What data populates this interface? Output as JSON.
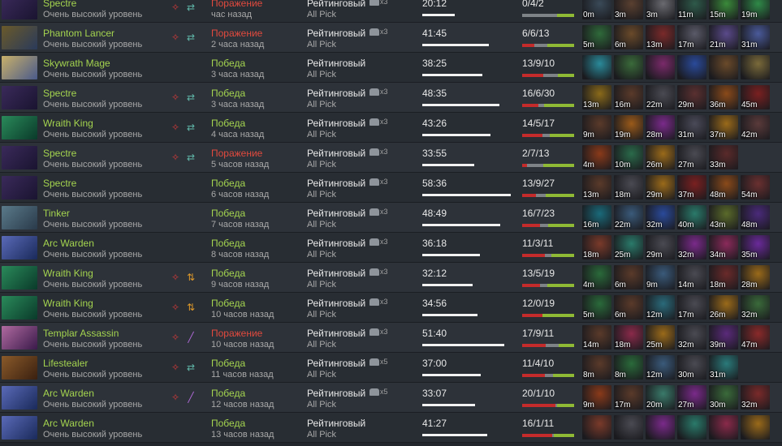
{
  "matches": [
    {
      "hero": "Spectre",
      "skill": "Очень высокий уровень",
      "tags": [
        "red",
        "swap"
      ],
      "result": "Поражение",
      "win": false,
      "ago": "час назад",
      "mode": "Рейтинговый",
      "party": "x3",
      "lobby": "All Pick",
      "duration": "20:12",
      "dur_frac": 0.33,
      "kda": "0/4/2",
      "k": 0,
      "d": 4,
      "a": 2,
      "items": [
        {
          "t": "0m",
          "c": "#3a4a58"
        },
        {
          "t": "3m",
          "c": "#5a4030"
        },
        {
          "t": "3m",
          "c": "#6a6a70"
        },
        {
          "t": "11m",
          "c": "#2e5a4a"
        },
        {
          "t": "15m",
          "c": "#3a8a3a"
        },
        {
          "t": "19m",
          "c": "#2f8a48"
        }
      ]
    },
    {
      "hero": "Phantom Lancer",
      "skill": "Очень высокий уровень",
      "tags": [
        "red",
        "swap"
      ],
      "result": "Поражение",
      "win": false,
      "ago": "2 часа назад",
      "mode": "Рейтинговый",
      "party": "x3",
      "lobby": "All Pick",
      "duration": "41:45",
      "dur_frac": 0.68,
      "kda": "6/6/13",
      "k": 6,
      "d": 6,
      "a": 13,
      "items": [
        {
          "t": "5m",
          "c": "#2f6a3a"
        },
        {
          "t": "6m",
          "c": "#6a4a2a"
        },
        {
          "t": "13m",
          "c": "#7a2a2a"
        },
        {
          "t": "17m",
          "c": "#5a5a68"
        },
        {
          "t": "21m",
          "c": "#5a4a8a"
        },
        {
          "t": "31m",
          "c": "#4a5a9a"
        }
      ]
    },
    {
      "hero": "Skywrath Mage",
      "skill": "Очень высокий уровень",
      "tags": [],
      "result": "Победа",
      "win": true,
      "ago": "3 часа назад",
      "mode": "Рейтинговый",
      "party": "",
      "lobby": "All Pick",
      "duration": "38:25",
      "dur_frac": 0.62,
      "kda": "13/9/10",
      "k": 13,
      "d": 9,
      "a": 10,
      "items": [
        {
          "t": "",
          "c": "#2a8a9a"
        },
        {
          "t": "",
          "c": "#3a6a3a"
        },
        {
          "t": "",
          "c": "#7a2a6a"
        },
        {
          "t": "",
          "c": "#2a4a9a"
        },
        {
          "t": "",
          "c": "#6a4a2a"
        },
        {
          "t": "",
          "c": "#7a6a3a"
        }
      ]
    },
    {
      "hero": "Spectre",
      "skill": "Очень высокий уровень",
      "tags": [
        "red",
        "swap"
      ],
      "result": "Победа",
      "win": true,
      "ago": "3 часа назад",
      "mode": "Рейтинговый",
      "party": "x3",
      "lobby": "All Pick",
      "duration": "48:35",
      "dur_frac": 0.79,
      "kda": "16/6/30",
      "k": 16,
      "d": 6,
      "a": 30,
      "items": [
        {
          "t": "13m",
          "c": "#8a6a1a"
        },
        {
          "t": "16m",
          "c": "#5a3a2a"
        },
        {
          "t": "22m",
          "c": "#4a4a52"
        },
        {
          "t": "29m",
          "c": "#5a3030"
        },
        {
          "t": "36m",
          "c": "#8a4a1a"
        },
        {
          "t": "45m",
          "c": "#7a2020"
        }
      ]
    },
    {
      "hero": "Wraith King",
      "skill": "Очень высокий уровень",
      "tags": [
        "red",
        "swap"
      ],
      "result": "Победа",
      "win": true,
      "ago": "4 часа назад",
      "mode": "Рейтинговый",
      "party": "x3",
      "lobby": "All Pick",
      "duration": "43:26",
      "dur_frac": 0.7,
      "kda": "14/5/17",
      "k": 14,
      "d": 5,
      "a": 17,
      "items": [
        {
          "t": "9m",
          "c": "#5a3a2a"
        },
        {
          "t": "19m",
          "c": "#9a5a1a"
        },
        {
          "t": "28m",
          "c": "#7a2a8a"
        },
        {
          "t": "31m",
          "c": "#4a4a58"
        },
        {
          "t": "37m",
          "c": "#9a6a1a"
        },
        {
          "t": "42m",
          "c": "#5a3a3a"
        }
      ]
    },
    {
      "hero": "Spectre",
      "skill": "Очень высокий уровень",
      "tags": [
        "red",
        "swap"
      ],
      "result": "Поражение",
      "win": false,
      "ago": "5 часов назад",
      "mode": "Рейтинговый",
      "party": "x3",
      "lobby": "All Pick",
      "duration": "33:55",
      "dur_frac": 0.53,
      "kda": "2/7/13",
      "k": 2,
      "d": 7,
      "a": 13,
      "items": [
        {
          "t": "4m",
          "c": "#8a3a1a"
        },
        {
          "t": "10m",
          "c": "#2a6a4a"
        },
        {
          "t": "26m",
          "c": "#9a6a1a"
        },
        {
          "t": "27m",
          "c": "#4a4a52"
        },
        {
          "t": "33m",
          "c": "#5a2a2a"
        }
      ]
    },
    {
      "hero": "Spectre",
      "skill": "Очень высокий уровень",
      "tags": [],
      "result": "Победа",
      "win": true,
      "ago": "6 часов назад",
      "mode": "Рейтинговый",
      "party": "x3",
      "lobby": "All Pick",
      "duration": "58:36",
      "dur_frac": 0.91,
      "kda": "13/9/27",
      "k": 13,
      "d": 9,
      "a": 27,
      "items": [
        {
          "t": "13m",
          "c": "#5a3a2a"
        },
        {
          "t": "18m",
          "c": "#4a4a52"
        },
        {
          "t": "29m",
          "c": "#9a6a1a"
        },
        {
          "t": "37m",
          "c": "#7a2020"
        },
        {
          "t": "48m",
          "c": "#8a4a1a"
        },
        {
          "t": "54m",
          "c": "#6a3030"
        }
      ]
    },
    {
      "hero": "Tinker",
      "skill": "Очень высокий уровень",
      "tags": [],
      "result": "Победа",
      "win": true,
      "ago": "7 часов назад",
      "mode": "Рейтинговый",
      "party": "x3",
      "lobby": "All Pick",
      "duration": "48:49",
      "dur_frac": 0.8,
      "kda": "16/7/23",
      "k": 16,
      "d": 7,
      "a": 23,
      "items": [
        {
          "t": "16m",
          "c": "#1a6a7a"
        },
        {
          "t": "22m",
          "c": "#3a5a7a"
        },
        {
          "t": "32m",
          "c": "#2a4a9a"
        },
        {
          "t": "40m",
          "c": "#2a7a6a"
        },
        {
          "t": "43m",
          "c": "#5a6a2a"
        },
        {
          "t": "48m",
          "c": "#4a2a7a"
        }
      ]
    },
    {
      "hero": "Arc Warden",
      "skill": "Очень высокий уровень",
      "tags": [],
      "result": "Победа",
      "win": true,
      "ago": "8 часов назад",
      "mode": "Рейтинговый",
      "party": "x3",
      "lobby": "All Pick",
      "duration": "36:18",
      "dur_frac": 0.59,
      "kda": "11/3/11",
      "k": 11,
      "d": 3,
      "a": 11,
      "items": [
        {
          "t": "18m",
          "c": "#7a3a2a"
        },
        {
          "t": "25m",
          "c": "#2a7a6a"
        },
        {
          "t": "29m",
          "c": "#4a4a52"
        },
        {
          "t": "32m",
          "c": "#7a2a8a"
        },
        {
          "t": "34m",
          "c": "#8a2a5a"
        },
        {
          "t": "35m",
          "c": "#6a2a9a"
        }
      ]
    },
    {
      "hero": "Wraith King",
      "skill": "Очень высокий уровень",
      "tags": [
        "red",
        "arrows"
      ],
      "result": "Победа",
      "win": true,
      "ago": "9 часов назад",
      "mode": "Рейтинговый",
      "party": "x3",
      "lobby": "All Pick",
      "duration": "32:12",
      "dur_frac": 0.52,
      "kda": "13/5/19",
      "k": 13,
      "d": 5,
      "a": 19,
      "items": [
        {
          "t": "4m",
          "c": "#2a6a3a"
        },
        {
          "t": "6m",
          "c": "#5a3a2a"
        },
        {
          "t": "9m",
          "c": "#3a5a7a"
        },
        {
          "t": "14m",
          "c": "#4a4a52"
        },
        {
          "t": "18m",
          "c": "#6a2a2a"
        },
        {
          "t": "28m",
          "c": "#9a6a1a"
        }
      ]
    },
    {
      "hero": "Wraith King",
      "skill": "Очень высокий уровень",
      "tags": [
        "red",
        "arrows"
      ],
      "result": "Победа",
      "win": true,
      "ago": "10 часов назад",
      "mode": "Рейтинговый",
      "party": "x3",
      "lobby": "All Pick",
      "duration": "34:56",
      "dur_frac": 0.57,
      "kda": "12/0/19",
      "k": 12,
      "d": 0,
      "a": 19,
      "items": [
        {
          "t": "5m",
          "c": "#2a6a3a"
        },
        {
          "t": "6m",
          "c": "#5a3a2a"
        },
        {
          "t": "12m",
          "c": "#2a6a7a"
        },
        {
          "t": "17m",
          "c": "#4a4a52"
        },
        {
          "t": "26m",
          "c": "#9a6a1a"
        },
        {
          "t": "32m",
          "c": "#3a6a3a"
        }
      ]
    },
    {
      "hero": "Templar Assassin",
      "skill": "Очень высокий уровень",
      "tags": [
        "red",
        "sword"
      ],
      "result": "Поражение",
      "win": false,
      "ago": "10 часов назад",
      "mode": "Рейтинговый",
      "party": "x3",
      "lobby": "All Pick",
      "duration": "51:40",
      "dur_frac": 0.84,
      "kda": "17/9/11",
      "k": 17,
      "d": 9,
      "a": 11,
      "items": [
        {
          "t": "14m",
          "c": "#5a3a2a"
        },
        {
          "t": "18m",
          "c": "#8a2a4a"
        },
        {
          "t": "25m",
          "c": "#9a6a1a"
        },
        {
          "t": "32m",
          "c": "#4a4a52"
        },
        {
          "t": "39m",
          "c": "#5a2a7a"
        },
        {
          "t": "47m",
          "c": "#8a2a2a"
        }
      ]
    },
    {
      "hero": "Lifestealer",
      "skill": "Очень высокий уровень",
      "tags": [
        "red",
        "swap"
      ],
      "result": "Победа",
      "win": true,
      "ago": "11 часов назад",
      "mode": "Рейтинговый",
      "party": "x5",
      "lobby": "All Pick",
      "duration": "37:00",
      "dur_frac": 0.6,
      "kda": "11/4/10",
      "k": 11,
      "d": 4,
      "a": 10,
      "items": [
        {
          "t": "8m",
          "c": "#5a3a2a"
        },
        {
          "t": "8m",
          "c": "#2a6a3a"
        },
        {
          "t": "12m",
          "c": "#3a5a7a"
        },
        {
          "t": "30m",
          "c": "#4a4a52"
        },
        {
          "t": "31m",
          "c": "#2a7a7a"
        }
      ]
    },
    {
      "hero": "Arc Warden",
      "skill": "Очень высокий уровень",
      "tags": [
        "red",
        "sword"
      ],
      "result": "Победа",
      "win": true,
      "ago": "12 часов назад",
      "mode": "Рейтинговый",
      "party": "x5",
      "lobby": "All Pick",
      "duration": "33:07",
      "dur_frac": 0.54,
      "kda": "20/1/10",
      "k": 20,
      "d": 1,
      "a": 10,
      "items": [
        {
          "t": "9m",
          "c": "#8a3a1a"
        },
        {
          "t": "17m",
          "c": "#5a3a2a"
        },
        {
          "t": "20m",
          "c": "#3a7a6a"
        },
        {
          "t": "27m",
          "c": "#7a2a8a"
        },
        {
          "t": "30m",
          "c": "#3a6a3a"
        },
        {
          "t": "32m",
          "c": "#7a2a2a"
        }
      ]
    },
    {
      "hero": "Arc Warden",
      "skill": "Очень высокий уровень",
      "tags": [],
      "result": "Победа",
      "win": true,
      "ago": "13 часов назад",
      "mode": "Рейтинговый",
      "party": "",
      "lobby": "All Pick",
      "duration": "41:27",
      "dur_frac": 0.67,
      "kda": "16/1/11",
      "k": 16,
      "d": 1,
      "a": 11,
      "items": [
        {
          "t": "",
          "c": "#7a3a2a"
        },
        {
          "t": "",
          "c": "#4a4a52"
        },
        {
          "t": "",
          "c": "#7a2a8a"
        },
        {
          "t": "",
          "c": "#2a7a6a"
        },
        {
          "t": "",
          "c": "#8a2a4a"
        },
        {
          "t": "",
          "c": "#9a6a1a"
        }
      ]
    }
  ],
  "colors": {
    "win": "#a4d44f",
    "loss": "#e24a3e",
    "kill": "#c42b2b",
    "death": "#7e8387",
    "assist": "#8fba35"
  }
}
